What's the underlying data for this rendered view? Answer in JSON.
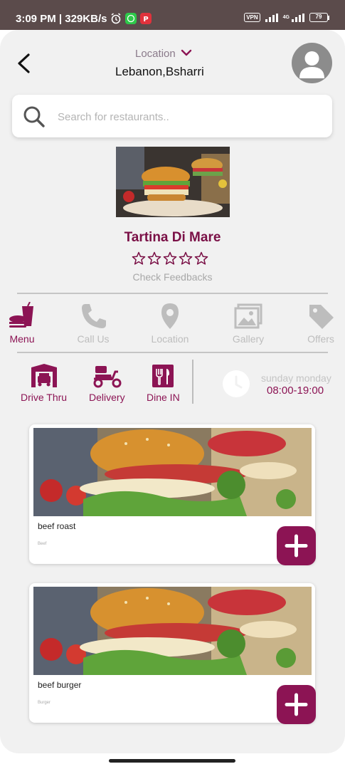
{
  "status_bar": {
    "time": "3:09 PM",
    "speed": "329KB/s",
    "vpn": "VPN",
    "network": "4G",
    "battery": "79"
  },
  "header": {
    "location_label": "Location",
    "location_value": "Lebanon,Bsharri"
  },
  "search": {
    "placeholder": "Search for restaurants.."
  },
  "restaurant": {
    "name": "Tartina Di Mare",
    "rating": 0,
    "rating_max": 5,
    "feedback_link": "Check Feedbacks"
  },
  "tabs": [
    {
      "label": "Menu",
      "icon": "menu-icon",
      "active": true
    },
    {
      "label": "Call Us",
      "icon": "phone-icon",
      "active": false
    },
    {
      "label": "Location",
      "icon": "map-pin-icon",
      "active": false
    },
    {
      "label": "Gallery",
      "icon": "gallery-icon",
      "active": false
    },
    {
      "label": "Offers",
      "icon": "tag-icon",
      "active": false
    }
  ],
  "services": [
    {
      "label": "Drive Thru",
      "icon": "drive-thru-icon"
    },
    {
      "label": "Delivery",
      "icon": "scooter-icon"
    },
    {
      "label": "Dine IN",
      "icon": "cutlery-icon"
    }
  ],
  "hours": {
    "days": "sunday monday",
    "time": "08:00-19:00"
  },
  "menu_items": [
    {
      "name": "beef roast",
      "category": "Beef"
    },
    {
      "name": "beef burger",
      "category": "Burger"
    }
  ],
  "colors": {
    "accent": "#8c1454",
    "status_bar": "#5b4b4b",
    "background": "#f1f1f1",
    "inactive": "#bdbdbd"
  }
}
